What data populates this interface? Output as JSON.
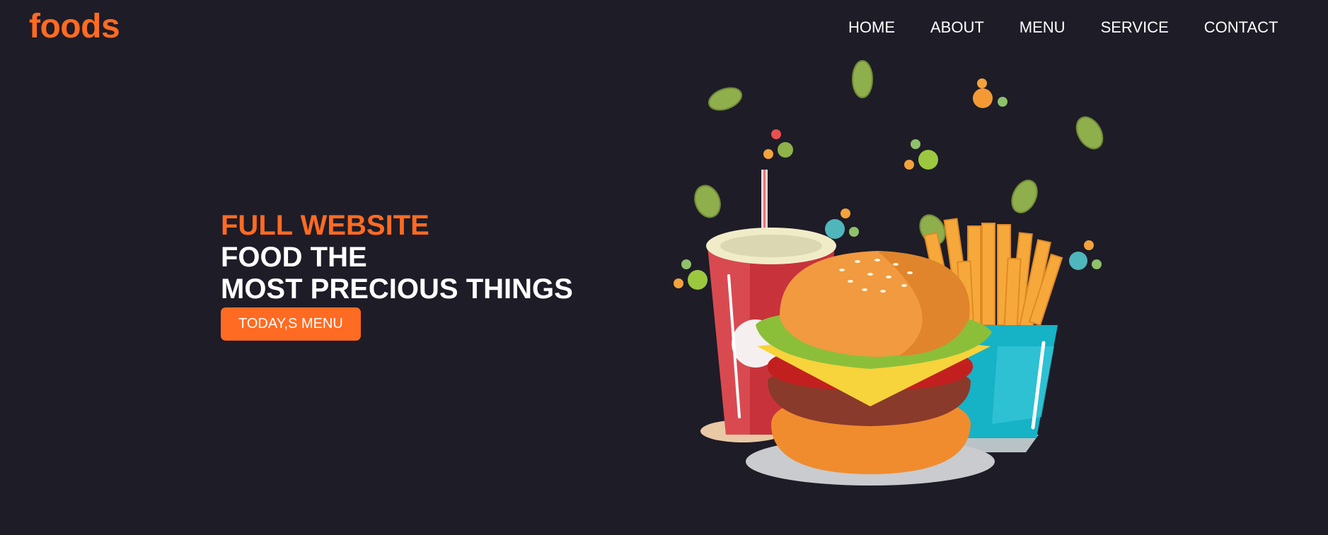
{
  "brand": {
    "logo": "foods",
    "accent_color": "#ff6b22",
    "background_color": "#1e1c27"
  },
  "nav": {
    "items": [
      {
        "label": "HOME"
      },
      {
        "label": "ABOUT"
      },
      {
        "label": "MENU"
      },
      {
        "label": "SERVICE"
      },
      {
        "label": "CONTACT"
      }
    ]
  },
  "hero": {
    "tagline": "FULL WEBSITE",
    "line1": "FOOD THE",
    "line2": "MOST PRECIOUS THINGS",
    "cta_label": "TODAY,S MENU"
  },
  "illustration": {
    "items": [
      "soda-cup-icon",
      "burger-icon",
      "fries-icon",
      "leaf-icon",
      "confetti-dot"
    ]
  }
}
